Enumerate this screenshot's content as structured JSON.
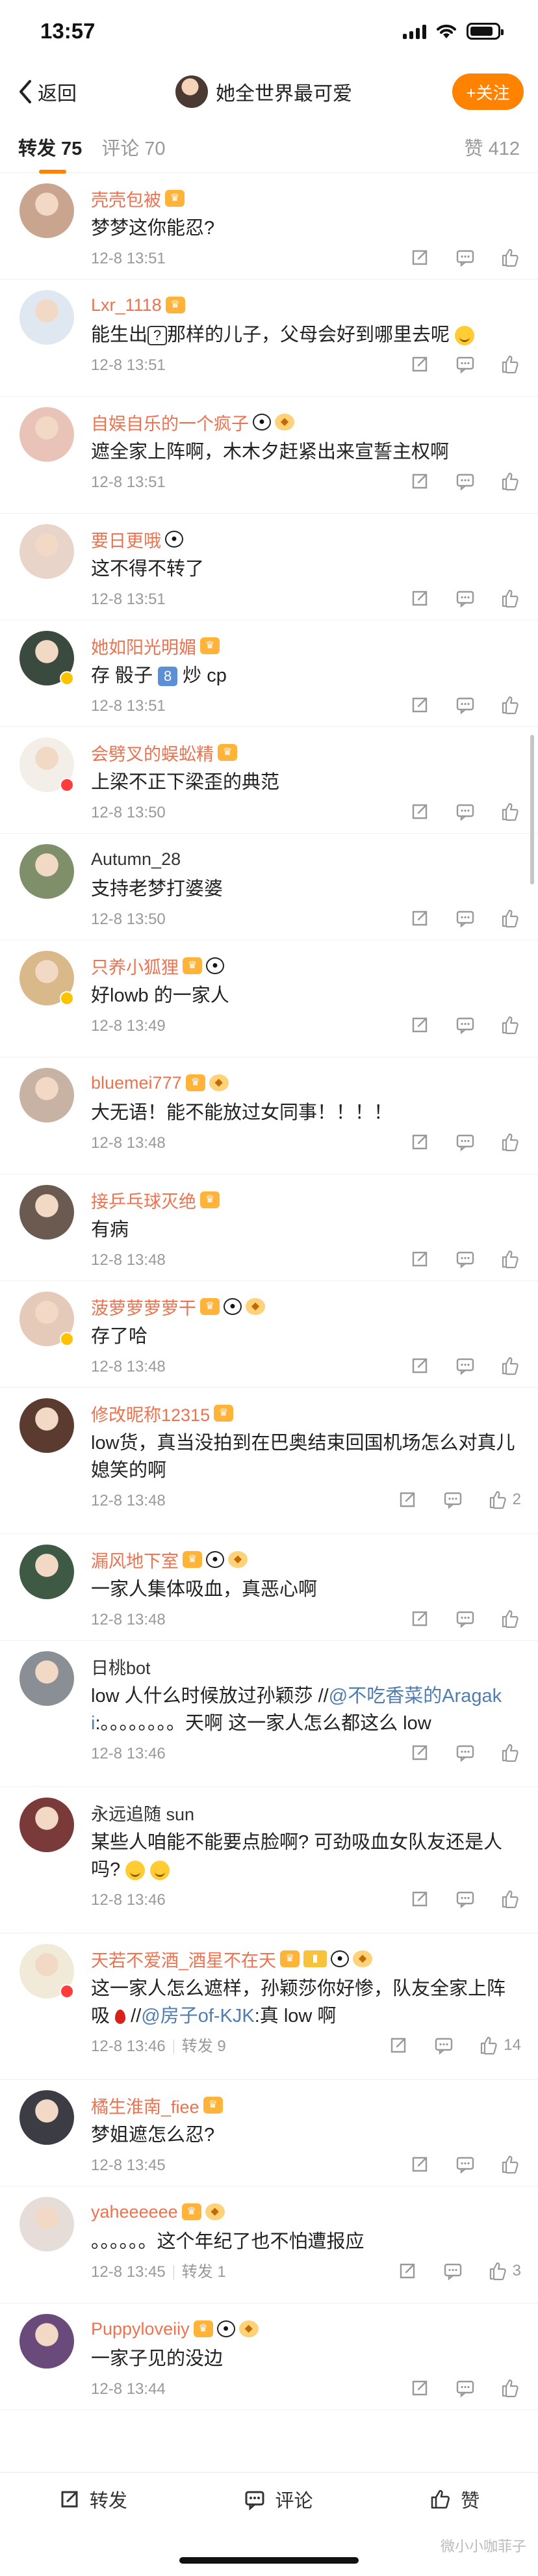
{
  "status_bar": {
    "time": "13:57",
    "battery_level": 0.85
  },
  "nav": {
    "back_label": "返回",
    "title": "她全世界最可爱",
    "follow_label": "+关注"
  },
  "tabs": {
    "repost_label": "转发",
    "repost_count": "75",
    "comment_label": "评论",
    "comment_count": "70",
    "likes_label": "赞",
    "likes_count": "412"
  },
  "comments": [
    {
      "name": "壳壳包被",
      "badges": [
        "crown"
      ],
      "text": "梦梦这你能忍?",
      "time": "12-8 13:51",
      "avatar_color": "#c9a48e"
    },
    {
      "name": "Lxr_1118",
      "badges": [
        "crown"
      ],
      "text_parts": [
        "能生出",
        "?",
        "那样的儿子，父母会好到哪里去呢"
      ],
      "time": "12-8 13:51",
      "avatar_color": "#dfe7f0"
    },
    {
      "name": "自娱自乐的一个疯子",
      "badges": [
        "panda",
        "cake"
      ],
      "text": "遮全家上阵啊，木木夕赶紧出来宣誓主权啊",
      "time": "12-8 13:51",
      "avatar_color": "#e9c3b8"
    },
    {
      "name": "要日更哦",
      "badges": [
        "panda"
      ],
      "text": "这不得不转了",
      "time": "12-8 13:51",
      "avatar_color": "#e8d4c8"
    },
    {
      "name": "她如阳光明媚",
      "badges": [
        "crown"
      ],
      "text_parts": [
        "存 骰子 ",
        "8",
        " 炒 cp"
      ],
      "time": "12-8 13:51",
      "avatar_color": "#3b4a3e"
    },
    {
      "name": "会劈叉的蜈蚣精",
      "badges": [
        "crown"
      ],
      "text": "上梁不正下梁歪的典范",
      "time": "12-8 13:50",
      "avatar_color": "#f3efe8"
    },
    {
      "name": "Autumn_28",
      "badges": [],
      "text": "支持老梦打婆婆",
      "time": "12-8 13:50",
      "avatar_color": "#7f8f6a"
    },
    {
      "name": "只养小狐狸",
      "badges": [
        "crown",
        "panda"
      ],
      "text": "好lowb 的一家人",
      "time": "12-8 13:49",
      "avatar_color": "#d9b98a"
    },
    {
      "name": "bluemei777",
      "badges": [
        "crown",
        "cake"
      ],
      "text": "大无语！能不能放过女同事！！！！",
      "time": "12-8 13:48",
      "avatar_color": "#c7b2a4"
    },
    {
      "name": "接乒乓球灭绝",
      "badges": [
        "crown"
      ],
      "text": "有病",
      "time": "12-8 13:48",
      "avatar_color": "#6a5a50"
    },
    {
      "name": "菠萝萝萝萝干",
      "badges": [
        "crown",
        "panda",
        "cake"
      ],
      "text": "存了哈",
      "time": "12-8 13:48",
      "avatar_color": "#e5c9b9"
    },
    {
      "name": "修改昵称12315",
      "badges": [
        "crown"
      ],
      "text": "low货，真当没拍到在巴奥结束回国机场怎么对真儿媳笑的啊",
      "time": "12-8 13:48",
      "likes": "2",
      "avatar_color": "#5b3a30"
    },
    {
      "name": "漏风地下室",
      "badges": [
        "crown",
        "panda",
        "cake"
      ],
      "text": "一家人集体吸血，真恶心啊",
      "time": "12-8 13:48",
      "avatar_color": "#3f5a44"
    },
    {
      "name": "日桃bot",
      "badges": [],
      "text_parts": [
        "low 人什么时候放过孙颖莎 //",
        "@不吃香菜的Aragaki",
        ":。。。。。。。。天啊 这一家人怎么都这么 low"
      ],
      "time": "12-8 13:46",
      "avatar_color": "#8a8f96"
    },
    {
      "name": "永远追随 sun",
      "badges": [],
      "text": "某些人咱能不能要点脸啊? 可劲吸血女队友还是人吗?",
      "time": "12-8 13:46",
      "avatar_color": "#7a3a3a"
    },
    {
      "name": "天若不爱酒_酒星不在天",
      "badges": [
        "crown",
        "tag",
        "panda",
        "cake"
      ],
      "text_parts": [
        "这一家人怎么遮样，孙颖莎你好惨，队友全家上阵吸",
        "//",
        "@房子of-KJK",
        ":真 low 啊"
      ],
      "time": "12-8 13:46",
      "repost": "转发 9",
      "likes": "14",
      "avatar_color": "#f1ead8"
    },
    {
      "name": "橘生淮南_fiee",
      "badges": [
        "crown"
      ],
      "text": "梦姐遮怎么忍?",
      "time": "12-8 13:45",
      "avatar_color": "#3c3c44"
    },
    {
      "name": "yaheeeeee",
      "badges": [
        "crown",
        "cake"
      ],
      "text": "。。。。。。这个年纪了也不怕遭报应",
      "time": "12-8 13:45",
      "repost": "转发 1",
      "likes": "3",
      "avatar_color": "#e7ddd8"
    },
    {
      "name": "Puppyloveiiy",
      "badges": [
        "crown",
        "panda",
        "cake"
      ],
      "text": "一家子见的没边",
      "time": "12-8 13:44",
      "avatar_color": "#6a4a7a"
    }
  ],
  "bottom_bar": {
    "repost_label": "转发",
    "comment_label": "评论",
    "like_label": "赞",
    "watermark": "微小小咖菲子"
  }
}
